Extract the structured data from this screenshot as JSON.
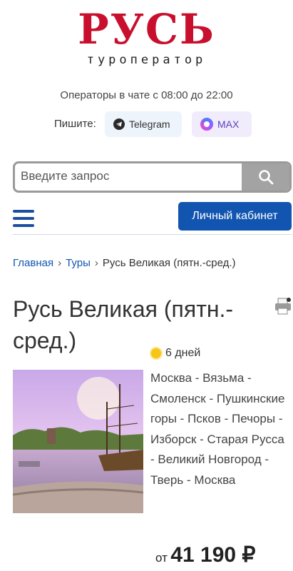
{
  "logo": {
    "title": "РУСЬ",
    "subtitle": "туроператор"
  },
  "contact": {
    "hours": "Операторы в чате с 08:00 до 22:00",
    "write_label": "Пишите:",
    "telegram_label": "Telegram",
    "max_label": "MAX"
  },
  "search": {
    "placeholder": "Введите запрос"
  },
  "nav": {
    "account_label": "Личный кабинет"
  },
  "breadcrumb": {
    "home": "Главная",
    "tours": "Туры",
    "current": "Русь Великая (пятн.-сред.)"
  },
  "tour": {
    "title": "Русь Великая (пятн.-сред.)",
    "days": "6 дней",
    "route": "Москва - Вязьма - Смоленск - Пушкинские горы - Псков - Печоры - Изборск - Старая Русса - Великий Новгород - Тверь - Москва",
    "price_prefix": "от",
    "price": "41 190 ₽"
  },
  "icons": {
    "telegram": "telegram-icon",
    "max": "max-icon",
    "search": "search-icon",
    "menu": "menu-icon",
    "print": "printer-icon",
    "sun": "sun-icon"
  },
  "colors": {
    "brand_red": "#c8102e",
    "primary_blue": "#1255b1",
    "search_gray": "#a3a3a3"
  }
}
